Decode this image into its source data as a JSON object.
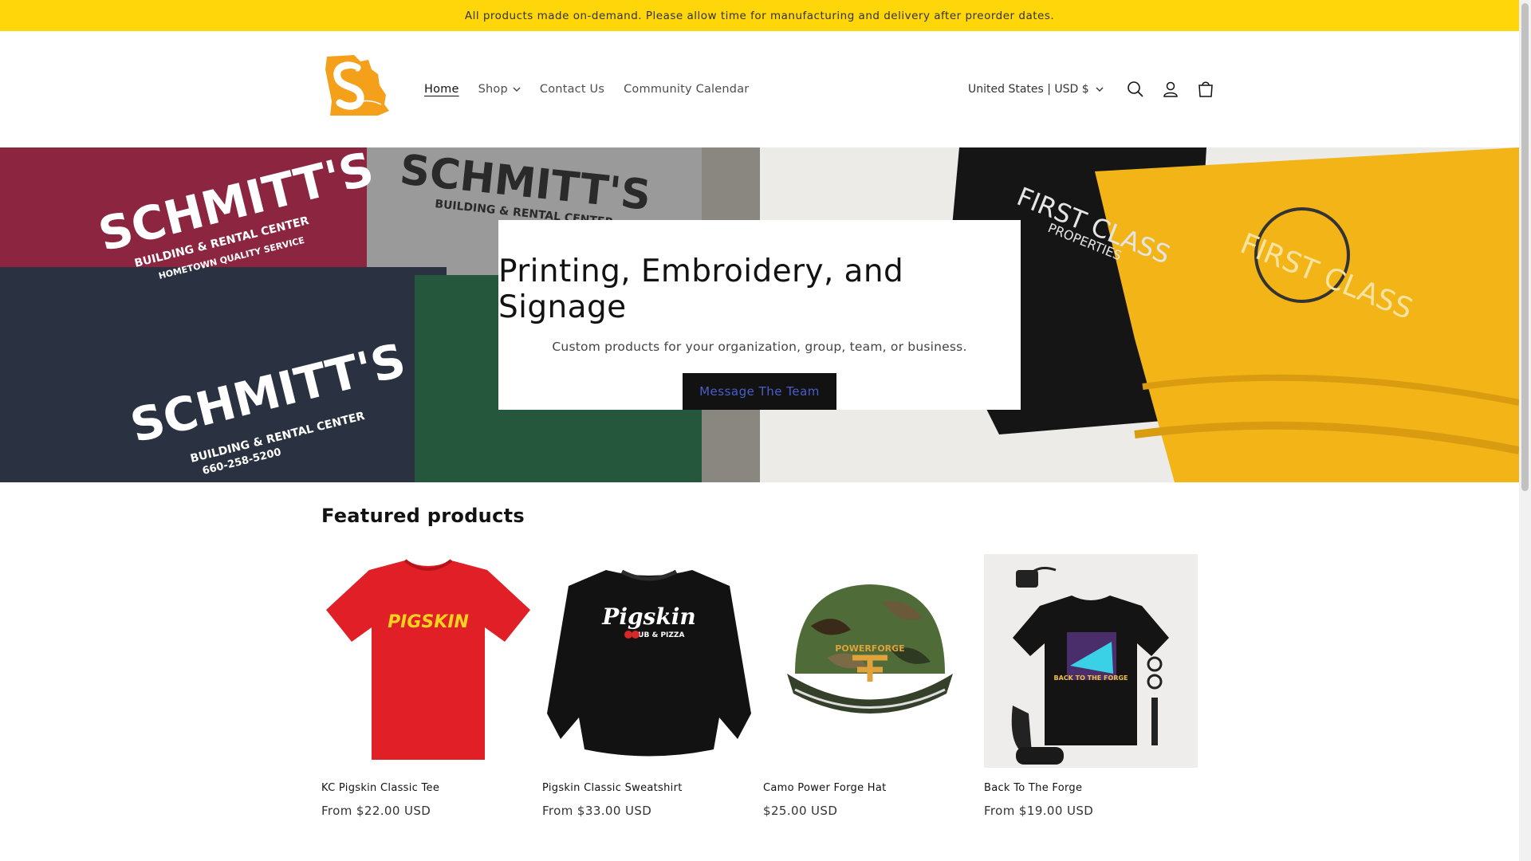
{
  "announcement": {
    "text": "All products made on-demand. Please allow time for manufacturing and delivery after preorder dates."
  },
  "header": {
    "logo_alt": "Shop logo",
    "nav": [
      {
        "label": "Home",
        "active": true
      },
      {
        "label": "Shop",
        "has_dropdown": true
      },
      {
        "label": "Contact Us"
      },
      {
        "label": "Community Calendar"
      }
    ],
    "country_selector": "United States | USD $",
    "icons": [
      "search-icon",
      "account-icon",
      "cart-icon"
    ]
  },
  "hero": {
    "title": "Printing, Embroidery, and Signage",
    "subtitle": "Custom products for your organization, group, team, or business.",
    "button_label": "Message The Team",
    "left_image_text": {
      "brand": "SCHMITT'S",
      "line1": "BUILDING & RENTAL CENTER",
      "line2": "HOMETOWN QUALITY SERVICE",
      "phone": "660-258-5200"
    },
    "right_image_text": {
      "brand": "FIRST CLASS",
      "line1": "PROPERTIES"
    }
  },
  "featured": {
    "title": "Featured products",
    "products": [
      {
        "name": "KC Pigskin Classic Tee",
        "price": "From $22.00 USD",
        "image_text": "PIGSKIN"
      },
      {
        "name": "Pigskin Classic Sweatshirt",
        "price": "From $33.00 USD",
        "image_text": "Pigskin",
        "image_text2": "PUB & PIZZA"
      },
      {
        "name": "Camo Power Forge Hat",
        "price": "$25.00 USD",
        "image_text": "POWERFORGE"
      },
      {
        "name": "Back To The Forge",
        "price": "From $19.00 USD",
        "image_text": "BACK TO THE FORGE"
      }
    ]
  },
  "colors": {
    "announcement_bg": "#ffd60a",
    "button_bg": "#121212",
    "button_text": "#4a5dc9",
    "logo_orange": "#f5a01a"
  }
}
